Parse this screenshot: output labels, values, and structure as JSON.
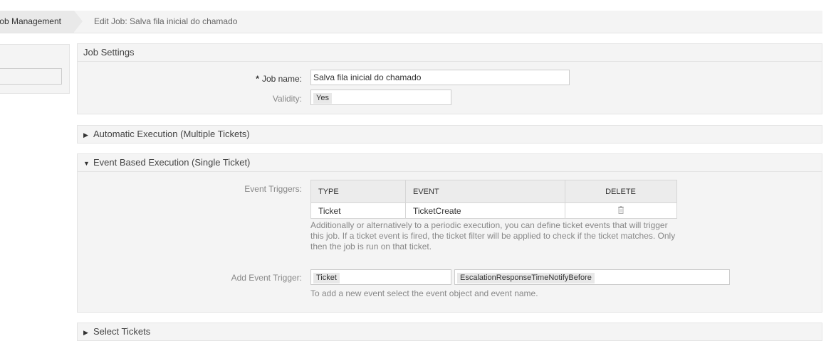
{
  "breadcrumb": {
    "first": "ob Management",
    "second": "Edit Job: Salva fila inicial do chamado"
  },
  "job_settings": {
    "title": "Job Settings",
    "job_name_label": "Job name:",
    "job_name_value": "Salva fila inicial do chamado",
    "validity_label": "Validity:",
    "validity_value": "Yes"
  },
  "automatic_execution": {
    "title": "Automatic Execution (Multiple Tickets)"
  },
  "event_execution": {
    "title": "Event Based Execution (Single Ticket)",
    "triggers_label": "Event Triggers:",
    "columns": [
      "TYPE",
      "EVENT",
      "DELETE"
    ],
    "rows": [
      {
        "type": "Ticket",
        "event": "TicketCreate"
      }
    ],
    "help_text": "Additionally or alternatively to a periodic execution, you can define ticket events that will trigger this job. If a ticket event is fired, the ticket filter will be applied to check if the ticket matches. Only then the job is run on that ticket.",
    "add_label": "Add Event Trigger:",
    "add_object_value": "Ticket",
    "add_event_value": "EscalationResponseTimeNotifyBefore",
    "add_help": "To add a new event select the event object and event name."
  },
  "select_tickets": {
    "title": "Select Tickets"
  },
  "icons": {
    "delete": "trash-icon",
    "expand": "triangle-right-icon",
    "collapse": "triangle-down-icon"
  }
}
